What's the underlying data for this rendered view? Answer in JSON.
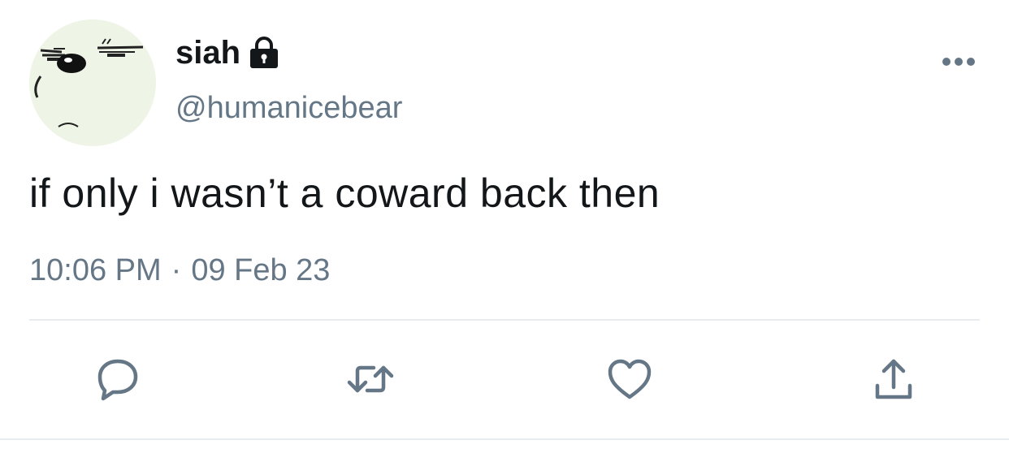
{
  "user": {
    "display_name": "siah",
    "handle": "@humanicebear",
    "protected_icon": "lock-icon",
    "avatar": "bear-face-avatar"
  },
  "tweet": {
    "text": "if only i wasn’t a coward back then",
    "time": "10:06 PM",
    "separator": "·",
    "date": "09 Feb 23"
  },
  "actions": {
    "reply_icon": "reply-icon",
    "retweet_icon": "retweet-icon",
    "like_icon": "heart-icon",
    "share_icon": "share-icon",
    "more_icon": "more-icon"
  },
  "colors": {
    "text": "#14171a",
    "secondary": "#657786",
    "divider": "#e6ecf0",
    "icon": "#657786"
  }
}
